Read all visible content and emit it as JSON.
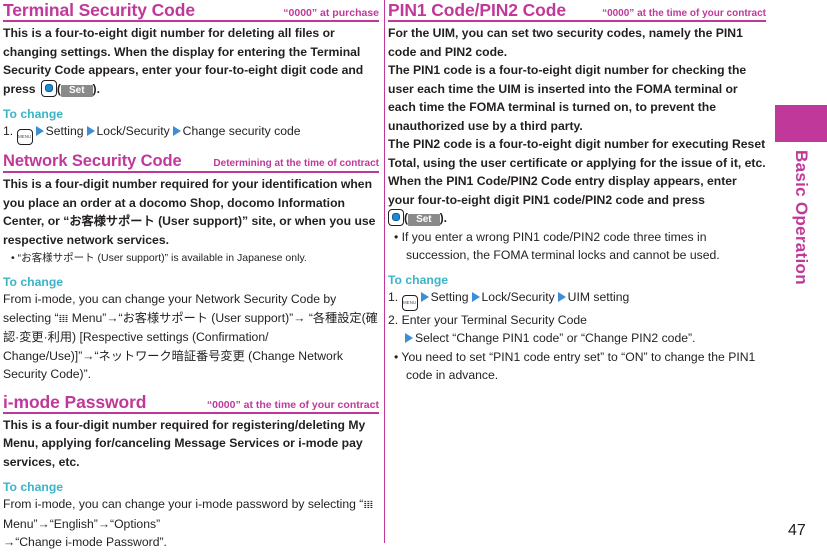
{
  "sidebar": {
    "label": "Basic Operation",
    "tab_color": "#c0399a"
  },
  "page_number": "47",
  "colors": {
    "accent_magenta": "#c0399a",
    "to_change_cyan": "#3bb4c8",
    "arrow_blue": "#3c8fd6"
  },
  "icons": {
    "menu_key": "MENU",
    "softkey_set": "Set",
    "arrow": "▶",
    "imode_menu": "𝍖"
  },
  "terminal": {
    "title": "Terminal Security Code",
    "note": "“0000” at purchase",
    "body_lines": [
      "This is a four-to-eight digit number for deleting all files or changing settings. When the display for entering the Terminal Security Code appears, enter your four-to-eight digit code and press"
    ],
    "body_after_key_open": "(",
    "body_after_key_close": ").",
    "to_change_label": "To change",
    "step1_prefix": "1.",
    "step1_items": [
      "Setting",
      "Lock/Security",
      "Change security code"
    ]
  },
  "network": {
    "title": "Network Security Code",
    "note": "Determining at the time of contract",
    "body": "This is a four-digit number required for your identification when you place an order at a docomo Shop, docomo Information Center, or “お客様サポート (User support)” site, or when you use respective network services.",
    "footnote": "• “お客様サポート (User support)” is available in Japanese only.",
    "to_change_label": "To change",
    "change_text_1": "From i-mode, you can change your Network Security Code by selecting “",
    "change_text_2": " Menu”→“お客様サポート (User support)”→ “各種設定(確認·変更·利用) [Respective settings (Confirmation/ Change/Use)]”→“ネットワーク暗証番号変更 (Change Network Security Code)”."
  },
  "imode": {
    "title": "i-mode Password",
    "note": "“0000” at the time of your contract",
    "body": "This is a four-digit number required for registering/deleting My Menu, applying for/canceling Message Services or i-mode pay services, etc.",
    "to_change_label": "To change",
    "change_text_1": "From i-mode, you can change your i-mode password by selecting “",
    "change_text_2": " Menu”→“English”→“Options”",
    "change_text_3": "→“Change i-mode Password”."
  },
  "pin": {
    "title": "PIN1 Code/PIN2 Code",
    "note": "“0000” at the time of your contract",
    "para1": "For the UIM, you can set two security codes, namely the PIN1 code and PIN2 code.",
    "para2": "The PIN1 code is a four-to-eight digit number for checking the user each time the UIM is inserted into the FOMA terminal or each time the FOMA terminal is turned on, to prevent the unauthorized use by a third party.",
    "para3": "The PIN2 code is a four-to-eight digit number for executing Reset Total, using the user certificate or applying for the issue of it, etc.",
    "para4": "When the PIN1 Code/PIN2 Code entry display appears, enter your four-to-eight digit PIN1 code/PIN2 code and press",
    "key_open": "(",
    "key_close": ").",
    "bullet1": "• If you enter a wrong PIN1 code/PIN2 code three times in succession, the FOMA terminal locks and cannot be used.",
    "to_change_label": "To change",
    "step1_prefix": "1.",
    "step1_items": [
      "Setting",
      "Lock/Security",
      "UIM setting"
    ],
    "step2_prefix": "2.",
    "step2_text": "Enter your Terminal Security Code",
    "step2_sub": "Select “Change PIN1 code” or “Change PIN2 code”.",
    "bullet2": "• You need to set “PIN1 code entry set” to “ON” to change the PIN1 code in advance."
  }
}
